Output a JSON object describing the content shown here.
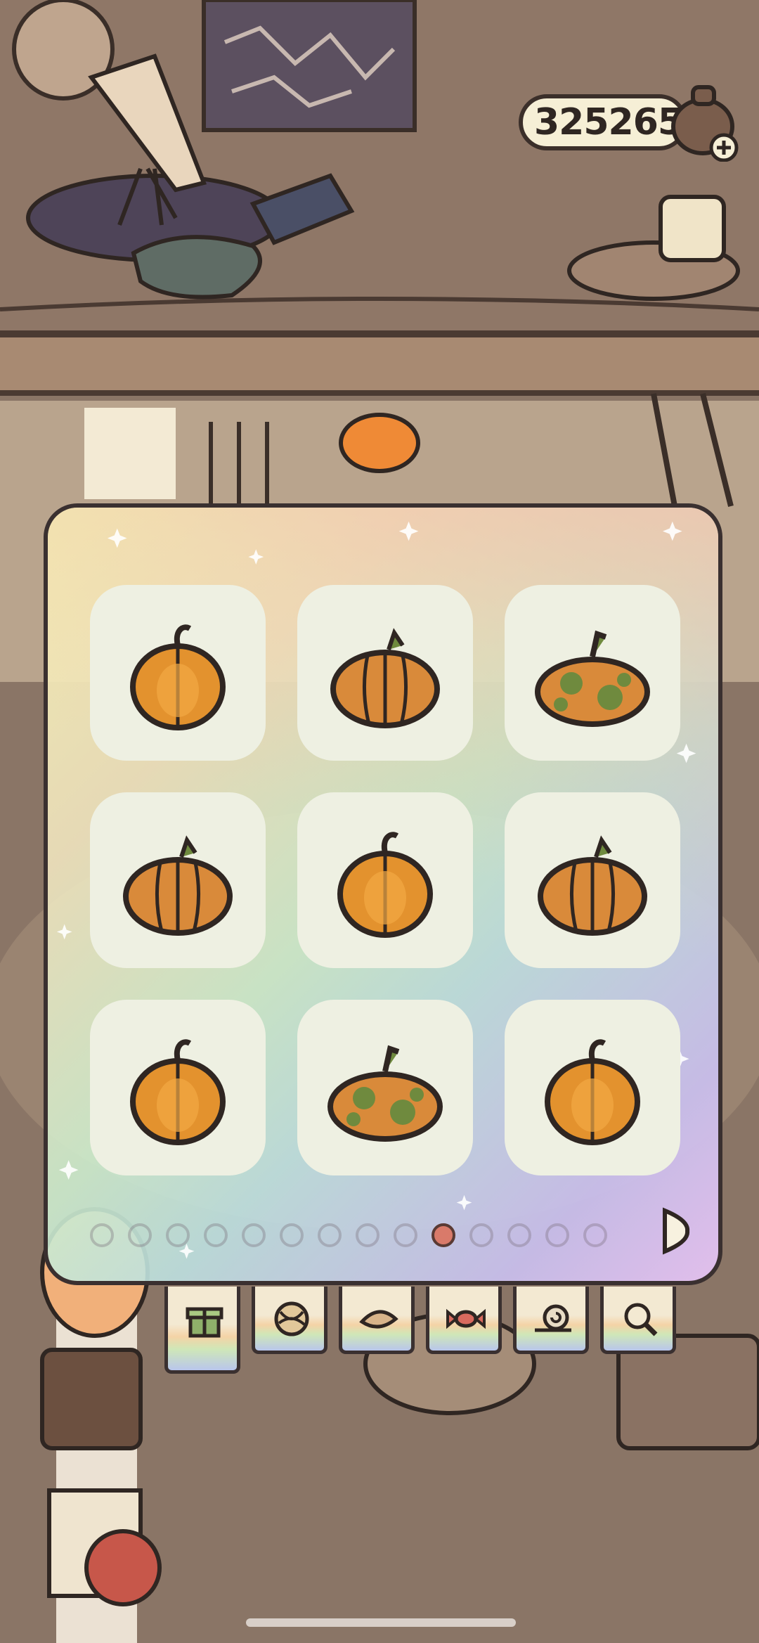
{
  "hud": {
    "coin_value": "325265",
    "coin_bag_icon": "coin-bag-icon",
    "add_icon": "plus-icon"
  },
  "inventory": {
    "items": [
      {
        "name": "round-orange-pumpkin"
      },
      {
        "name": "wide-orange-pumpkin"
      },
      {
        "name": "spotted-green-pumpkin"
      },
      {
        "name": "wide-orange-pumpkin"
      },
      {
        "name": "round-orange-pumpkin"
      },
      {
        "name": "wide-orange-pumpkin"
      },
      {
        "name": "round-orange-pumpkin"
      },
      {
        "name": "spotted-green-pumpkin"
      },
      {
        "name": "round-orange-pumpkin"
      }
    ],
    "pager": {
      "total_pages": 14,
      "current_page": 10
    },
    "next_icon": "chevron-right-icon"
  },
  "tabs": [
    {
      "icon": "gift-icon",
      "active": true
    },
    {
      "icon": "yarn-ball-icon",
      "active": false
    },
    {
      "icon": "leaf-icon",
      "active": false
    },
    {
      "icon": "candy-icon",
      "active": false
    },
    {
      "icon": "snail-icon",
      "active": false
    },
    {
      "icon": "magnifier-icon",
      "active": false
    }
  ],
  "colors": {
    "active_page_dot": "#d97a6a",
    "panel_border": "#3a3030",
    "slot_bg": "#eef0e2",
    "pumpkin_orange": "#e3922e",
    "pumpkin_green": "#6f8a3e"
  }
}
